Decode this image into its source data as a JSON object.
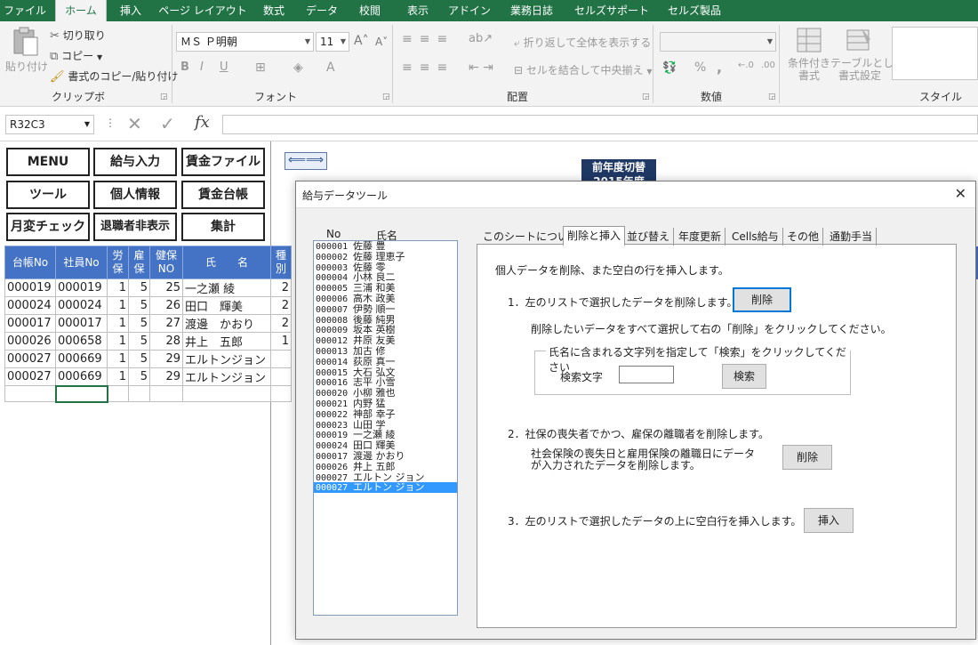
{
  "ribbon_tabs": [
    "ファイル",
    "ホーム",
    "挿入",
    "ページ レイアウト",
    "数式",
    "データ",
    "校閲",
    "表示",
    "アドイン",
    "業務日誌",
    "セルズサポート",
    "セルズ製品"
  ],
  "clipboard": {
    "paste": "貼り付け",
    "cut": "切り取り",
    "copy": "コピー",
    "format_painter": "書式のコピー/貼り付け",
    "group": "クリップボード"
  },
  "font": {
    "name": "ＭＳ Ｐ明朝",
    "size": "11",
    "bold": "B",
    "italic": "I",
    "underline": "U",
    "group": "フォント"
  },
  "alignment": {
    "wrap": "折り返して全体を表示する",
    "merge": "セルを結合して中央揃え",
    "group": "配置"
  },
  "number": {
    "percent": "%",
    "comma": ",",
    "group": "数値"
  },
  "styles": {
    "conditional": "条件付き\n書式",
    "table": "テーブルとして\n書式設定",
    "group": "スタイル"
  },
  "formula_bar": {
    "name_box": "R32C3",
    "fx": "fx"
  },
  "sheet_buttons": [
    "MENU",
    "給与入力",
    "賃金ファイル",
    "ツール",
    "個人情報",
    "賃金台帳",
    "月変チェック",
    "退職者非表示",
    "集計"
  ],
  "arrow_button": "⟸⟹",
  "prev_year": {
    "line1": "前年度切替",
    "line2": "2015年度"
  },
  "table": {
    "headers": [
      "台帳No",
      "社員No",
      "労\n保",
      "雇\n保",
      "健保\nNO",
      "氏　　名",
      "種\n別"
    ],
    "rows": [
      [
        "000019",
        "000019",
        "1",
        "5",
        "25",
        "一之瀬 綾",
        "2"
      ],
      [
        "000024",
        "000024",
        "1",
        "5",
        "26",
        "田口　輝美",
        "2"
      ],
      [
        "000017",
        "000017",
        "1",
        "5",
        "27",
        "渡邊　かおり",
        "2"
      ],
      [
        "000026",
        "000658",
        "1",
        "5",
        "28",
        "井上　五郎",
        "1"
      ],
      [
        "000027",
        "000669",
        "1",
        "5",
        "29",
        "エルトンジョン",
        ""
      ],
      [
        "000027",
        "000669",
        "1",
        "5",
        "29",
        "エルトンジョン",
        ""
      ],
      [
        "",
        "",
        "",
        "",
        "",
        "",
        ""
      ]
    ]
  },
  "dialog": {
    "title": "給与データツール",
    "list_header_no": "No",
    "list_header_name": "氏名",
    "list": [
      [
        "000001",
        "佐藤 豊"
      ],
      [
        "000002",
        "佐藤 理恵子"
      ],
      [
        "000003",
        "佐藤 零"
      ],
      [
        "000004",
        "小林 良二"
      ],
      [
        "000005",
        "三浦 和美"
      ],
      [
        "000006",
        "高木 政美"
      ],
      [
        "000007",
        "伊勢 順一"
      ],
      [
        "000008",
        "後藤 純男"
      ],
      [
        "000009",
        "坂本 英樹"
      ],
      [
        "000012",
        "井原 友美"
      ],
      [
        "000013",
        "加古 修"
      ],
      [
        "000014",
        "荻原 真一"
      ],
      [
        "000015",
        "大石 弘文"
      ],
      [
        "000016",
        "志平 小雪"
      ],
      [
        "000020",
        "小柳 雅也"
      ],
      [
        "000021",
        "内野 猛"
      ],
      [
        "000022",
        "神部 幸子"
      ],
      [
        "000023",
        "山田 学"
      ],
      [
        "000019",
        "一之瀬 綾"
      ],
      [
        "000024",
        "田口 輝美"
      ],
      [
        "000017",
        "渡邊 かおり"
      ],
      [
        "000026",
        "井上 五郎"
      ],
      [
        "000027",
        "エルトン ジョン"
      ],
      [
        "000027",
        "エルトン ジョン"
      ]
    ],
    "tabs": [
      "このシートについて",
      "削除と挿入",
      "並び替え",
      "年度更新",
      "Cells給与",
      "その他",
      "通勤手当"
    ],
    "intro": "個人データを削除、また空白の行を挿入します。",
    "step1": "1．左のリストで選択したデータを削除します。",
    "step1_hint": "削除したいデータをすべて選択して右の「削除」をクリックしてください。",
    "delete_btn": "削除",
    "search_group": "氏名に含まれる文字列を指定して「検索」をクリックしてください",
    "search_label": "検索文字",
    "search_value": "",
    "search_btn": "検索",
    "step2": "2．社保の喪失者でかつ、雇保の離職者を削除します。",
    "step2_desc1": "社会保険の喪失日と雇用保険の離職日にデータ",
    "step2_desc2": "が入力されたデータを削除します。",
    "delete2_btn": "削除",
    "step3": "3．左のリストで選択したデータの上に空白行を挿入します。",
    "insert_btn": "挿入"
  }
}
